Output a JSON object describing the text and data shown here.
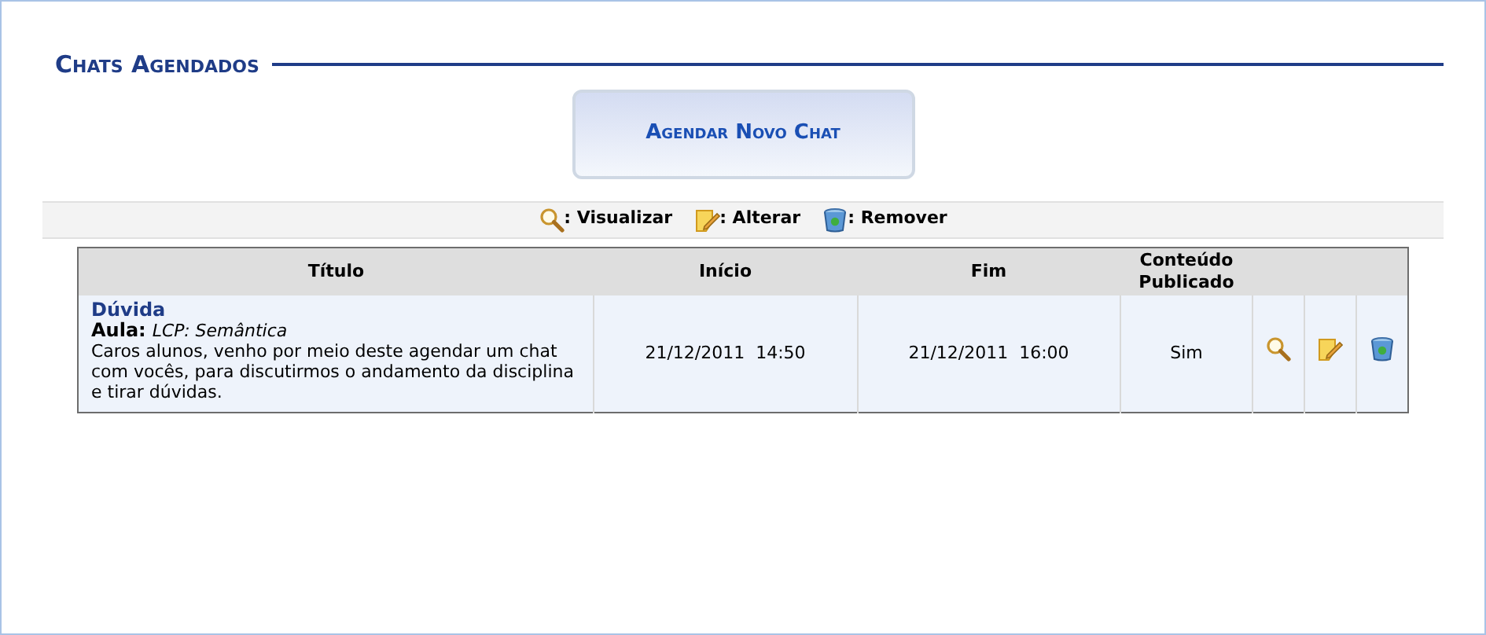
{
  "title": "Chats Agendados",
  "new_button": "Agendar Novo Chat",
  "legend": [
    {
      "kind": "view",
      "label": ": Visualizar"
    },
    {
      "kind": "edit",
      "label": ": Alterar"
    },
    {
      "kind": "remove",
      "label": ": Remover"
    }
  ],
  "table": {
    "columns": [
      "Título",
      "Início",
      "Fim",
      "Conteúdo Publicado"
    ],
    "rows": [
      {
        "title": "Dúvida",
        "class_label": "Aula:",
        "class_name": "LCP: Semântica",
        "description": "Caros alunos, venho por meio deste agendar um chat com vocês, para discutirmos o andamento da disciplina e tirar dúvidas.",
        "start": "21/12/2011  14:50",
        "end": "21/12/2011  16:00",
        "published": "Sim",
        "actions": [
          {
            "kind": "view"
          },
          {
            "kind": "edit"
          },
          {
            "kind": "remove"
          }
        ]
      }
    ]
  }
}
